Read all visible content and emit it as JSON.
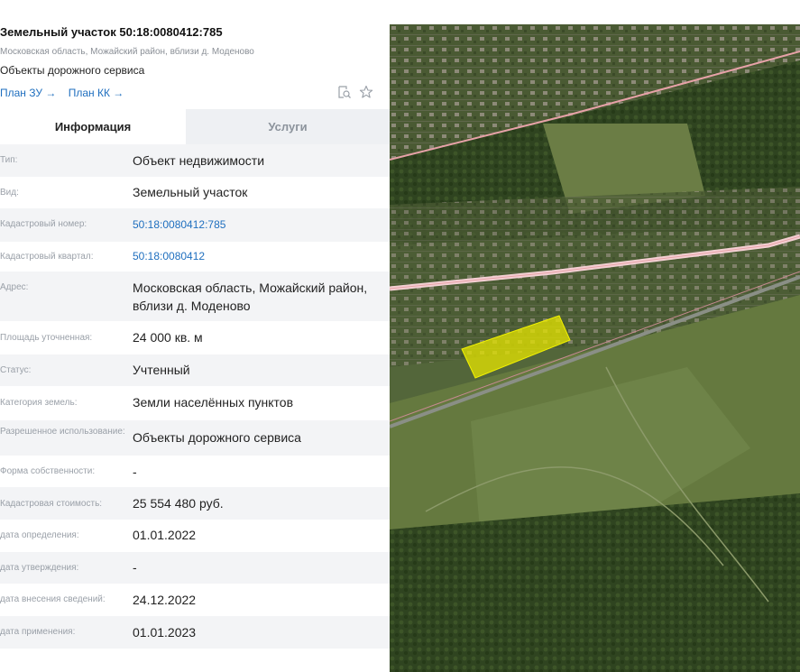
{
  "parcel": {
    "title": "Земельный участок 50:18:0080412:785",
    "address": "Московская область, Можайский район, вблизи д. Моденово",
    "usage": "Объекты дорожного сервиса",
    "links": [
      "План ЗУ →",
      "План КК →"
    ]
  },
  "icons": [
    "search-document-icon",
    "star-icon"
  ],
  "tabs": [
    "Информация",
    "Услуги"
  ],
  "rows": [
    {
      "label": "Тип:",
      "value": "Объект недвижимости"
    },
    {
      "label": "Вид:",
      "value": "Земельный участок"
    },
    {
      "label": "Кадастровый номер:",
      "value": "50:18:0080412:785"
    },
    {
      "label": "Кадастровый квартал:",
      "value": "50:18:0080412"
    },
    {
      "label": "Адрес:",
      "value": "Московская область, Можайский район, вблизи д. Моденово"
    },
    {
      "label": "Площадь уточненная:",
      "value": "24 000 кв. м"
    },
    {
      "label": "Статус:",
      "value": "Учтенный"
    },
    {
      "label": "Категория земель:",
      "value": "Земли населённых пунктов"
    },
    {
      "label": "Разрешенное использование:",
      "value": "Объекты дорожного сервиса"
    },
    {
      "label": "Форма собственности:",
      "value": "-"
    },
    {
      "label": "Кадастровая стоимость:",
      "value": "25 554 480 руб."
    },
    {
      "label": "дата определения:",
      "value": "01.01.2022"
    },
    {
      "label": "дата утверждения:",
      "value": "-"
    },
    {
      "label": "дата внесения сведений:",
      "value": "24.12.2022"
    },
    {
      "label": "дата применения:",
      "value": "01.01.2023"
    }
  ],
  "colors": {
    "link": "#1f6fbf",
    "row_alt": "#f3f4f6",
    "parcel_highlight": "#e6e600"
  }
}
